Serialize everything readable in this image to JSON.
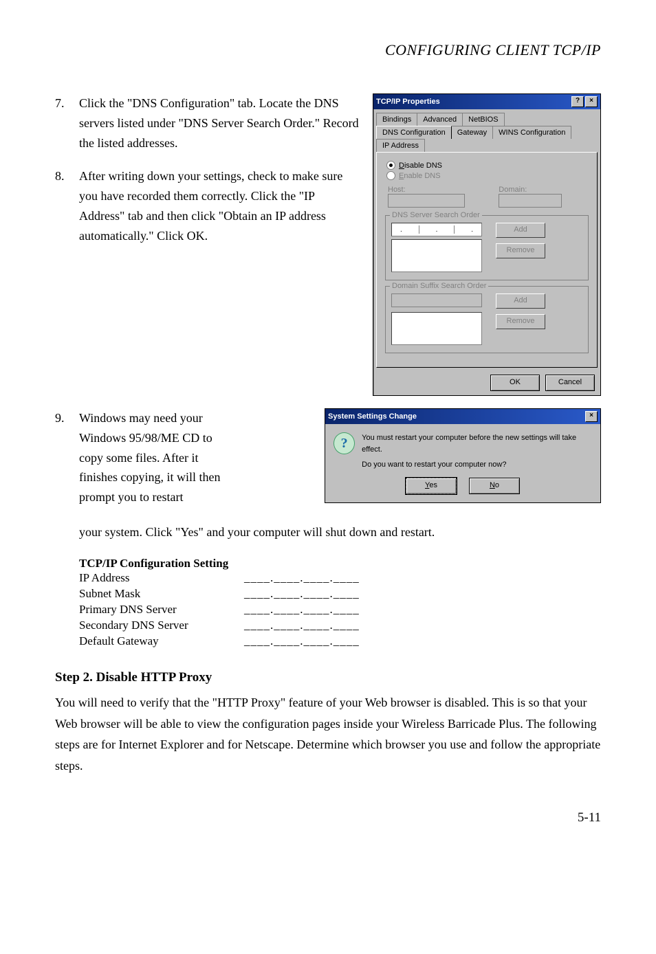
{
  "header": "CONFIGURING CLIENT TCP/IP",
  "steps": {
    "s7": {
      "num": "7.",
      "text": "Click the \"DNS Configuration\" tab. Locate the DNS servers listed under \"DNS Server Search Order.\" Record the listed addresses."
    },
    "s8": {
      "num": "8.",
      "text": "After writing down your settings, check to make sure you have recorded them correctly. Click the \"IP Address\" tab and then click \"Obtain an IP address automatically.\" Click OK."
    },
    "s9": {
      "num": "9.",
      "text_a": "Windows may need your Windows 95/98/ME CD to copy some files. After it finishes copying, it will then prompt you to restart",
      "text_b": "your system. Click \"Yes\" and your computer will shut down and restart."
    }
  },
  "config": {
    "heading": "TCP/IP Configuration Setting",
    "rows": [
      {
        "label": "IP Address"
      },
      {
        "label": "Subnet Mask"
      },
      {
        "label": "Primary DNS Server"
      },
      {
        "label": "Secondary DNS Server"
      },
      {
        "label": "Default Gateway"
      }
    ],
    "blank": "____.____.____.____"
  },
  "step2": {
    "heading": "Step 2. Disable HTTP Proxy",
    "body": "You will need to verify that the \"HTTP Proxy\" feature of your Web browser is disabled. This is so that your Web browser will be able to view the configuration pages inside your Wireless Barricade Plus. The following steps are for Internet Explorer and for Netscape. Determine which browser you use and follow the appropriate steps."
  },
  "pagenum": "5-11",
  "tcpip_dialog": {
    "title": "TCP/IP Properties",
    "help_btn": "?",
    "close_btn": "×",
    "tabs_row1": [
      "Bindings",
      "Advanced",
      "NetBIOS"
    ],
    "tabs_row2": [
      "DNS Configuration",
      "Gateway",
      "WINS Configuration",
      "IP Address"
    ],
    "radio_disable": "Disable DNS",
    "radio_enable": "Enable DNS",
    "host_label": "Host:",
    "domain_label": "Domain:",
    "group1_legend": "DNS Server Search Order",
    "group2_legend": "Domain Suffix Search Order",
    "btn_add": "Add",
    "btn_remove": "Remove",
    "btn_ok": "OK",
    "btn_cancel": "Cancel"
  },
  "sys_dialog": {
    "title": "System Settings Change",
    "line1": "You must restart your computer before the new settings will take effect.",
    "line2": "Do you want to restart your computer now?",
    "yes": "Yes",
    "no": "No"
  }
}
